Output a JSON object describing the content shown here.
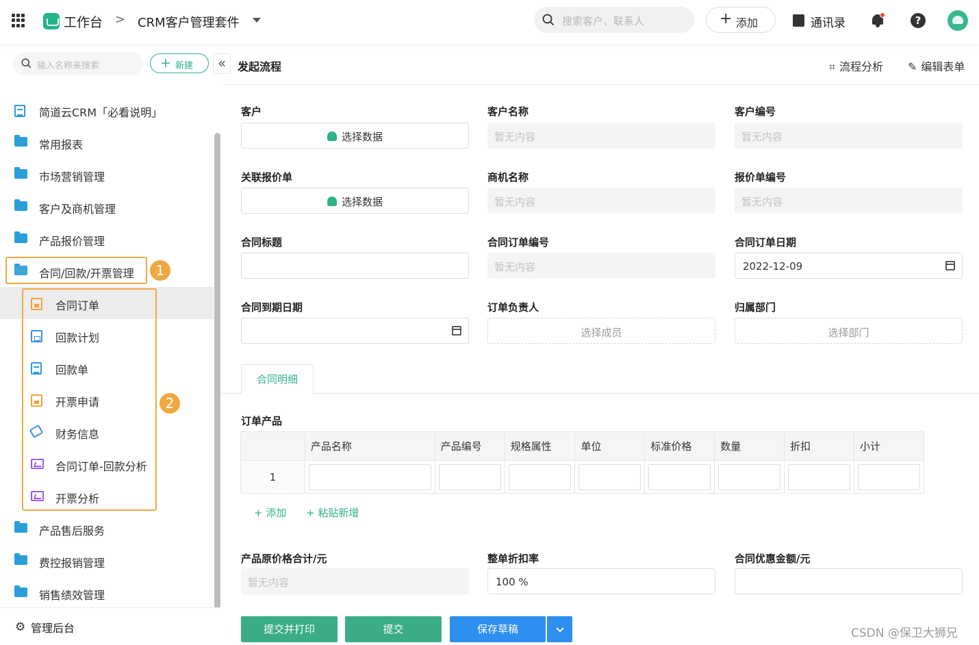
{
  "topbar": {
    "workspace": "工作台",
    "separator": ">",
    "app_name": "CRM客户管理套件",
    "search_placeholder": "搜索客户、联系人",
    "add_label": "添加",
    "contacts_label": "通讯录",
    "help_label": "?"
  },
  "sidebar": {
    "search_placeholder": "输入名称来搜索",
    "new_label": "新建",
    "collapse_glyph": "«",
    "items": [
      {
        "label": "简道云CRM「必看说明」",
        "icon": "document-icon"
      },
      {
        "label": "常用报表",
        "icon": "folder-icon"
      },
      {
        "label": "市场营销管理",
        "icon": "folder-icon"
      },
      {
        "label": "客户及商机管理",
        "icon": "folder-icon"
      },
      {
        "label": "产品报价管理",
        "icon": "folder-icon"
      },
      {
        "label": "合同/回款/开票管理",
        "icon": "folder-open-icon"
      },
      {
        "label": "合同订单",
        "icon": "form-orange-icon",
        "active": true
      },
      {
        "label": "回款计划",
        "icon": "form-blue-icon"
      },
      {
        "label": "回款单",
        "icon": "document-icon"
      },
      {
        "label": "开票申请",
        "icon": "form-orange-icon"
      },
      {
        "label": "财务信息",
        "icon": "tag-icon"
      },
      {
        "label": "合同订单-回款分析",
        "icon": "chart-icon"
      },
      {
        "label": "开票分析",
        "icon": "chart-icon"
      },
      {
        "label": "产品售后服务",
        "icon": "folder-icon"
      },
      {
        "label": "费控报销管理",
        "icon": "folder-icon"
      },
      {
        "label": "销售绩效管理",
        "icon": "folder-icon"
      }
    ],
    "badge1": "1",
    "badge2": "2",
    "admin_label": "管理后台"
  },
  "main": {
    "title": "发起流程",
    "flow_analysis": "流程分析",
    "edit_form": "编辑表单",
    "fields": {
      "customer": {
        "label": "客户",
        "button": "选择数据"
      },
      "customer_name": {
        "label": "客户名称",
        "placeholder": "暂无内容"
      },
      "customer_no": {
        "label": "客户编号",
        "placeholder": "暂无内容"
      },
      "quote": {
        "label": "关联报价单",
        "button": "选择数据"
      },
      "opportunity": {
        "label": "商机名称",
        "placeholder": "暂无内容"
      },
      "quote_no": {
        "label": "报价单编号",
        "placeholder": "暂无内容"
      },
      "contract_title": {
        "label": "合同标题"
      },
      "order_no": {
        "label": "合同订单编号",
        "placeholder": "暂无内容"
      },
      "order_date": {
        "label": "合同订单日期",
        "value": "2022-12-09"
      },
      "expire_date": {
        "label": "合同到期日期"
      },
      "owner": {
        "label": "订单负责人",
        "placeholder": "选择成员"
      },
      "department": {
        "label": "归属部门",
        "placeholder": "选择部门"
      }
    },
    "tab_label": "合同明细",
    "subform": {
      "label": "订单产品",
      "columns": [
        "产品名称",
        "产品编号",
        "规格属性",
        "单位",
        "标准价格",
        "数量",
        "折扣",
        "小计"
      ],
      "row_number": "1",
      "add_label": "添加",
      "paste_label": "粘贴新增"
    },
    "summary": {
      "original_total": {
        "label": "产品原价格合计/元",
        "placeholder": "暂无内容"
      },
      "discount_rate": {
        "label": "整单折扣率",
        "value": "100 %"
      },
      "discount_amount": {
        "label": "合同优惠金额/元"
      }
    },
    "buttons": {
      "submit_print": "提交并打印",
      "submit": "提交",
      "save_draft": "保存草稿"
    }
  },
  "watermark": "CSDN @保卫大狮兄",
  "colors": {
    "accent": "#2fb380",
    "highlight": "#f0a840",
    "primary": "#2d8ff0"
  }
}
